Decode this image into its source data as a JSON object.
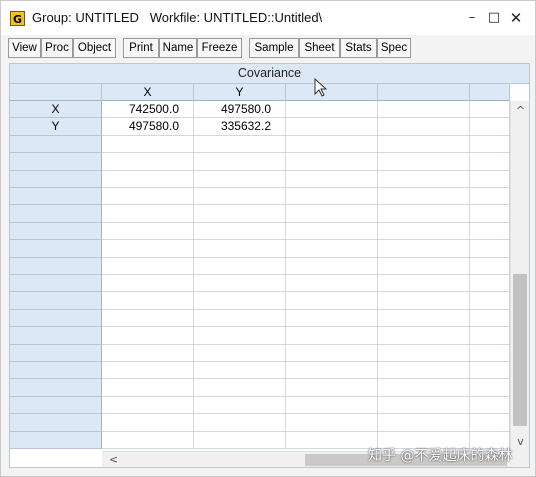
{
  "window": {
    "icon_letter": "G",
    "title": "Group: UNTITLED   Workfile: UNTITLED::Untitled\\",
    "controls": {
      "minimize": "–",
      "maximize": "□",
      "close": "✕"
    }
  },
  "toolbar": {
    "buttons": [
      "View",
      "Proc",
      "Object",
      "Print",
      "Name",
      "Freeze",
      "Sample",
      "Sheet",
      "Stats",
      "Spec"
    ]
  },
  "grid": {
    "title": "Covariance",
    "columns": [
      "X",
      "Y",
      "",
      "",
      ""
    ],
    "rows": [
      {
        "label": "X",
        "values": [
          "742500.0",
          "497580.0",
          "",
          ""
        ]
      },
      {
        "label": "Y",
        "values": [
          "497580.0",
          "335632.2",
          "",
          ""
        ]
      }
    ],
    "empty_rows": 18
  },
  "scrollbar": {
    "up_arrow": "^",
    "down_arrow": "v",
    "left_arrow": "<"
  },
  "watermark": "知乎 @不爱起床的森林"
}
